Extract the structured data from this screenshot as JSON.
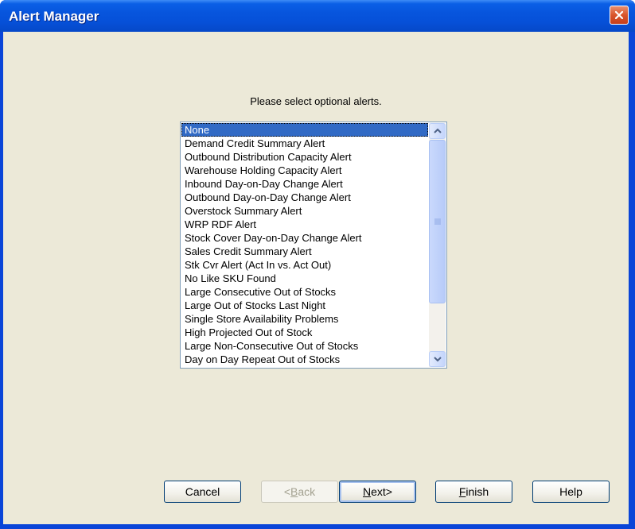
{
  "window": {
    "title": "Alert Manager"
  },
  "prompt": "Please select optional alerts.",
  "alerts": {
    "selected_index": 0,
    "items": [
      "None",
      "Demand Credit Summary Alert",
      "Outbound Distribution Capacity Alert",
      "Warehouse Holding Capacity Alert",
      "Inbound Day-on-Day Change Alert",
      "Outbound Day-on-Day Change Alert",
      "Overstock Summary Alert",
      "WRP RDF Alert",
      "Stock Cover Day-on-Day Change Alert",
      "Sales Credit Summary Alert",
      "Stk Cvr Alert (Act In vs. Act Out)",
      "No Like SKU Found",
      "Large Consecutive Out of Stocks",
      "Large Out of Stocks Last Night",
      "Single Store Availability Problems",
      "High Projected Out of Stock",
      "Large Non-Consecutive Out of Stocks",
      "Day on Day Repeat Out of Stocks"
    ]
  },
  "buttons": {
    "cancel": "Cancel",
    "back_prefix": "<",
    "back_accel": "B",
    "back_rest": "ack",
    "next_accel": "N",
    "next_rest": "ext>",
    "finish_accel": "F",
    "finish_rest": "inish",
    "help": "Help"
  },
  "colors": {
    "titlebar": "#0a5fe6",
    "selection": "#316ac5",
    "dialog_bg": "#ece9d8",
    "close_button": "#d9552b"
  },
  "icons": {
    "close": "close-icon",
    "scroll_up": "chevron-up-icon",
    "scroll_down": "chevron-down-icon",
    "thumb_grip": "grip-icon"
  }
}
